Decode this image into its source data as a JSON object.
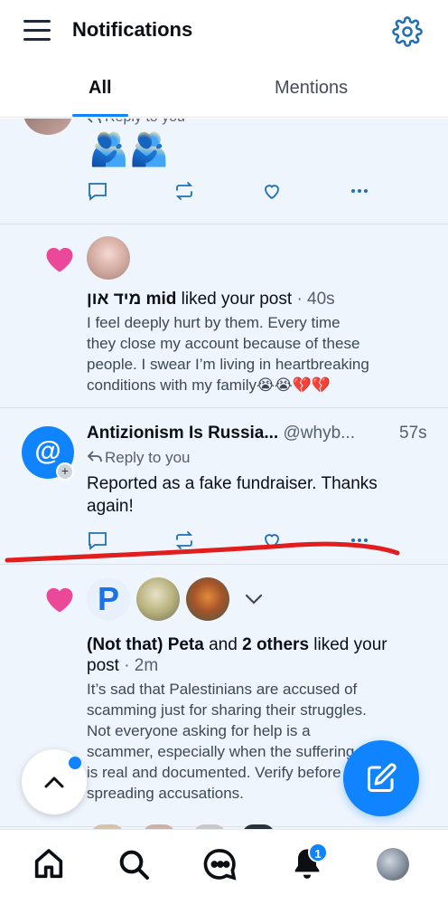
{
  "header": {
    "title": "Notifications"
  },
  "tabs": [
    {
      "label": "All",
      "active": true
    },
    {
      "label": "Mentions",
      "active": false
    }
  ],
  "colors": {
    "accent": "#1083fe",
    "like": "#ec4899",
    "annotation": "#e11d1d"
  },
  "items": [
    {
      "type": "reply-partial",
      "reply_label": "Reply to you",
      "emojis": "🫂🫂"
    },
    {
      "type": "like",
      "user": "מיד און mid",
      "action": "liked your post",
      "time": "· 40s",
      "snippet_lines": [
        "I feel deeply hurt by them. Every time",
        "they close my account because of these",
        "people. I swear I’m living in heartbreaking",
        "conditions with my family😭😭💔💔"
      ]
    },
    {
      "type": "mention",
      "user": "Antizionism Is Russia...",
      "handle": "@whyb...",
      "time": "57s",
      "reply_label": "Reply to you",
      "text_lines": [
        "Reported as a fake fundraiser. Thanks",
        "again!"
      ]
    },
    {
      "type": "like-group",
      "user": "(Not that) Peta",
      "and": "and",
      "others": "2 others",
      "action": "liked",
      "action2": "your post",
      "time": "· 2m",
      "snippet_lines": [
        "It’s sad that Palestinians are accused of",
        "scamming just for sharing their struggles.",
        "Not everyone asking for help is a",
        "scammer, especially when the suffering",
        "is real and documented. Verify before",
        "spreading accusations."
      ]
    }
  ],
  "nav": {
    "items": [
      "home",
      "search",
      "chat",
      "notifications",
      "profile"
    ],
    "notification_badge": "1"
  }
}
